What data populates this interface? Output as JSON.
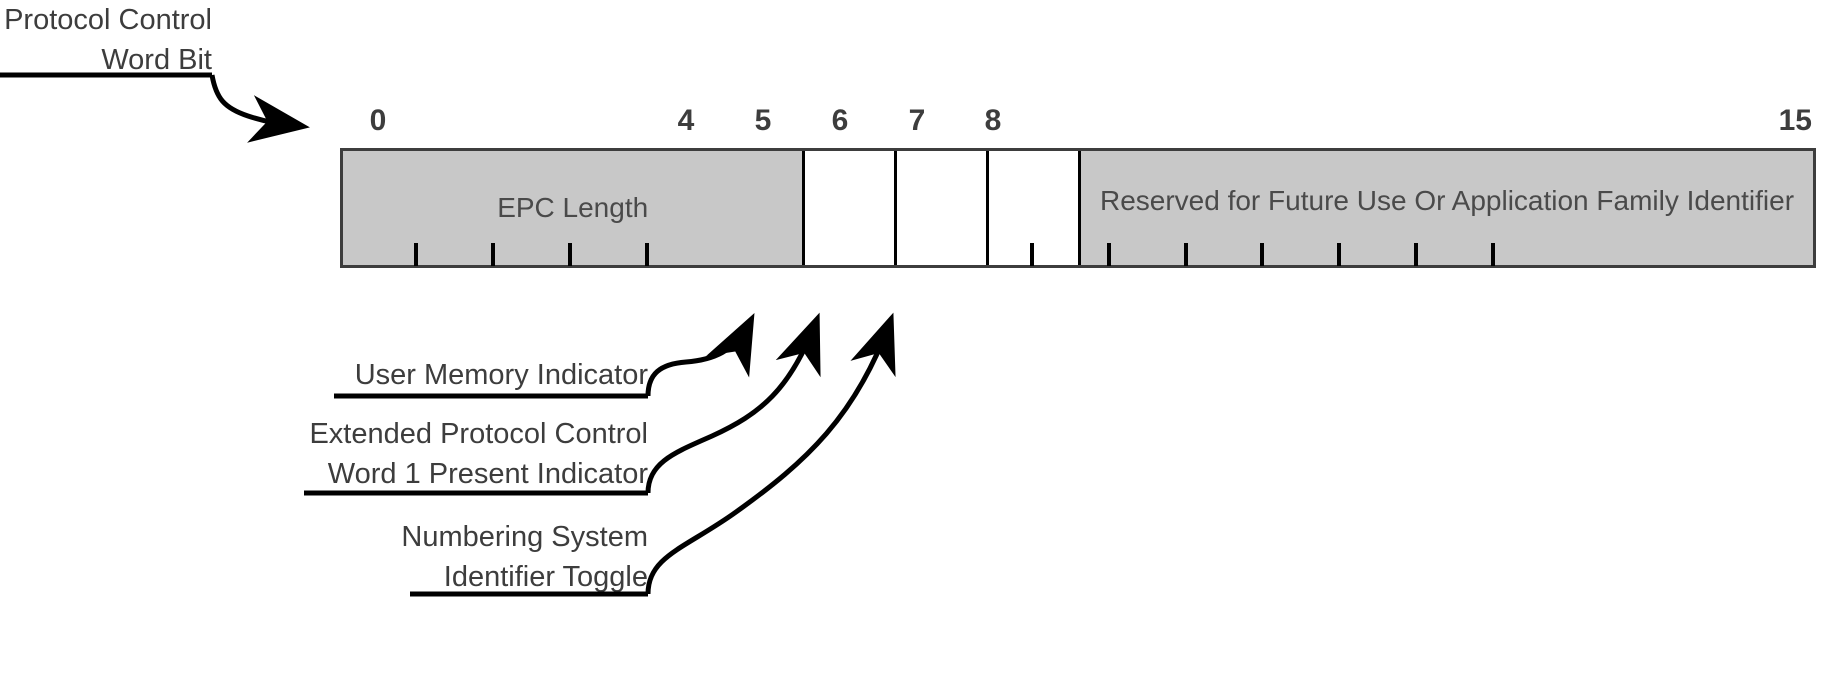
{
  "diagram": {
    "title_callout": {
      "label": "Protocol Control\nWord Bit",
      "points_to": "bit-ruler-start"
    },
    "bit_ruler": {
      "labels": [
        "0",
        "4",
        "5",
        "6",
        "7",
        "8",
        "15"
      ],
      "bits_total": 16
    },
    "bar": {
      "fields": [
        {
          "name": "EPC Length",
          "label": "EPC Length",
          "bit_start": 0,
          "bit_end": 4,
          "fill": "#c8c8c8"
        },
        {
          "name": "User Memory Indicator",
          "label": "",
          "bit_start": 5,
          "bit_end": 5,
          "fill": "#ffffff"
        },
        {
          "name": "Extended Protocol Control Word 1 Present Indicator",
          "label": "",
          "bit_start": 6,
          "bit_end": 6,
          "fill": "#ffffff"
        },
        {
          "name": "Numbering System Identifier Toggle",
          "label": "",
          "bit_start": 7,
          "bit_end": 7,
          "fill": "#ffffff"
        },
        {
          "name": "Reserved for Future Use Or Application Family Identifier",
          "label": "Reserved for Future Use Or\nApplication Family Identifier",
          "bit_start": 8,
          "bit_end": 15,
          "fill": "#c8c8c8"
        }
      ]
    },
    "callouts": [
      {
        "id": "user-memory-indicator",
        "label": "User Memory Indicator",
        "target_bit": 5
      },
      {
        "id": "extended-pcw1-present-indicator",
        "label": "Extended Protocol Control\nWord 1 Present Indicator",
        "target_bit": 6
      },
      {
        "id": "numbering-system-identifier-toggle",
        "label": "Numbering System\nIdentifier Toggle",
        "target_bit": 7
      }
    ],
    "colors": {
      "field_fill": "#c8c8c8",
      "empty_fill": "#ffffff",
      "stroke": "#3d3d3d",
      "divider": "#000000",
      "text": "#3d3d3d",
      "background": "#ffffff"
    }
  }
}
